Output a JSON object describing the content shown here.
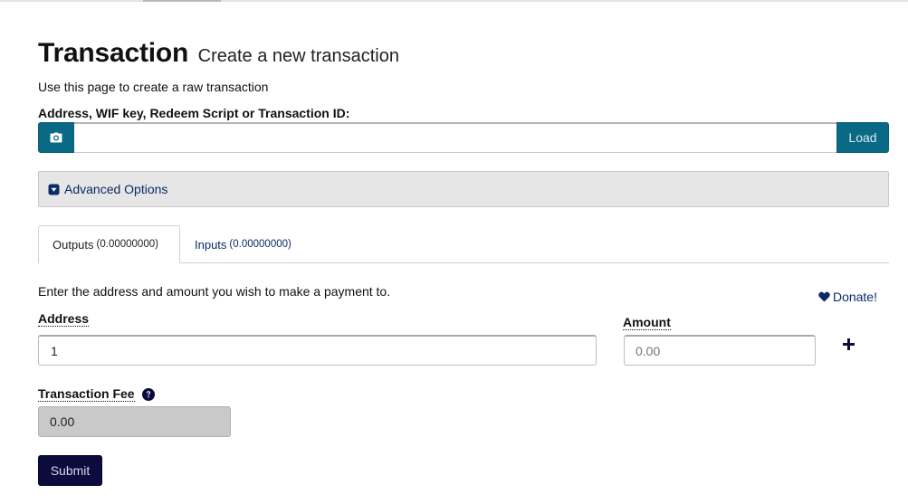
{
  "header": {
    "title": "Transaction",
    "subtitle": "Create a new transaction",
    "intro": "Use this page to create a raw transaction"
  },
  "load": {
    "label": "Address, WIF key, Redeem Script or Transaction ID:",
    "value": "",
    "button_label": "Load",
    "camera_icon": "camera-icon"
  },
  "advanced": {
    "label": "Advanced Options",
    "icon": "caret-square-down-icon"
  },
  "tabs": [
    {
      "label": "Outputs",
      "amount": "(0.00000000)",
      "active": true
    },
    {
      "label": "Inputs",
      "amount": "(0.00000000)",
      "active": false
    }
  ],
  "outputs": {
    "intro": "Enter the address and amount you wish to make a payment to.",
    "donate_label": "Donate!",
    "address_label": "Address",
    "address_value": "1",
    "amount_label": "Amount",
    "amount_placeholder": "0.00",
    "add_icon": "plus-icon"
  },
  "fee": {
    "label": "Transaction Fee",
    "value": "0.00",
    "help_icon": "question-circle-icon"
  },
  "submit_label": "Submit",
  "colors": {
    "primary_button": "#0a6a85",
    "submit_button": "#0c0b3d",
    "link": "#0b2a66",
    "panel_bg": "#e6e6e6",
    "disabled_input_bg": "#c9c9c9"
  }
}
